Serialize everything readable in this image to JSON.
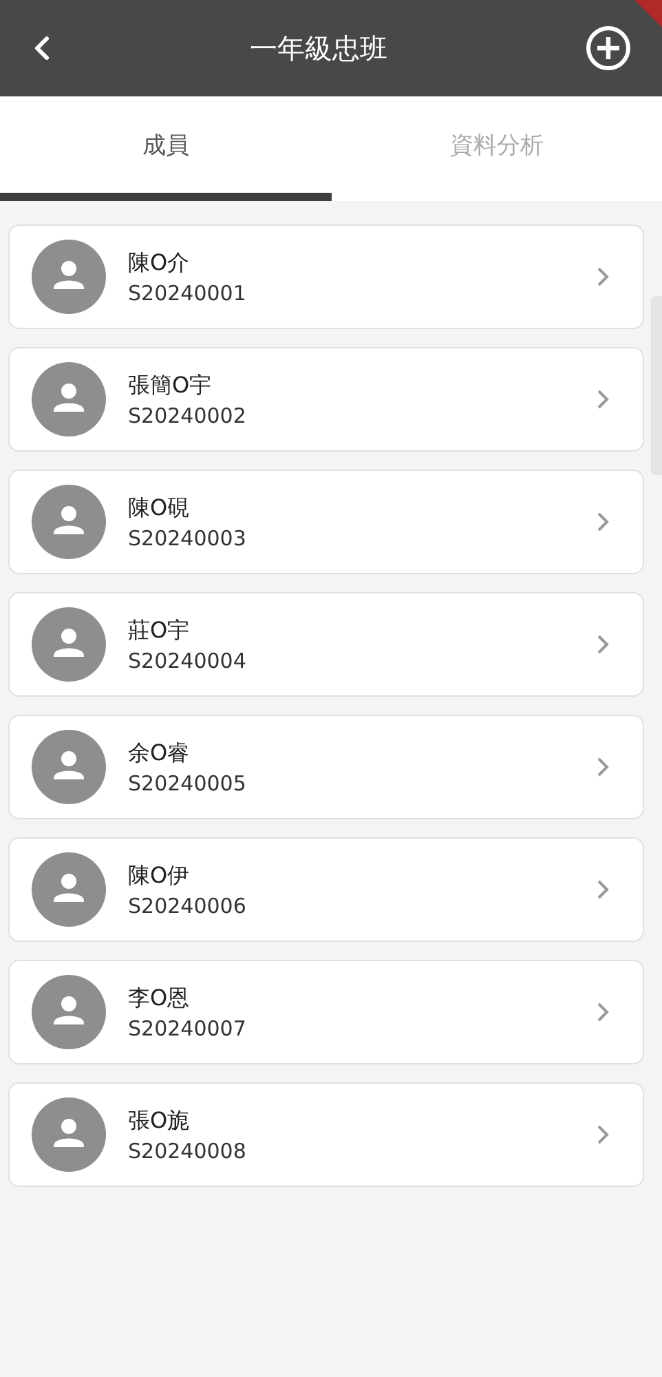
{
  "header": {
    "title": "一年級忠班"
  },
  "tabs": [
    {
      "label": "成員",
      "selected": true
    },
    {
      "label": "資料分析",
      "selected": false
    }
  ],
  "members": [
    {
      "name": "陳O介",
      "id": "S20240001"
    },
    {
      "name": "張簡O宇",
      "id": "S20240002"
    },
    {
      "name": "陳O硯",
      "id": "S20240003"
    },
    {
      "name": "莊O宇",
      "id": "S20240004"
    },
    {
      "name": "余O睿",
      "id": "S20240005"
    },
    {
      "name": "陳O伊",
      "id": "S20240006"
    },
    {
      "name": "李O恩",
      "id": "S20240007"
    },
    {
      "name": "張O旎",
      "id": "S20240008"
    }
  ]
}
